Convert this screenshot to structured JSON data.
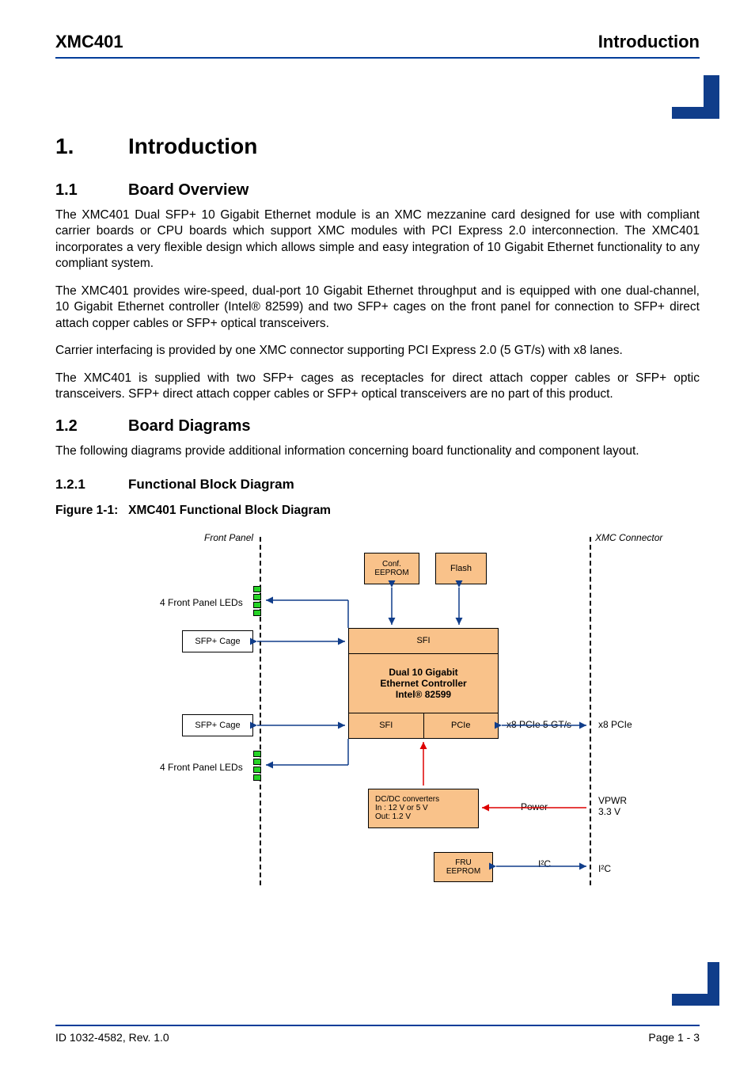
{
  "header": {
    "left": "XMC401",
    "right": "Introduction"
  },
  "chapter": {
    "num": "1.",
    "title": "Introduction"
  },
  "s11": {
    "num": "1.1",
    "title": "Board Overview",
    "p1": "The XMC401 Dual SFP+ 10 Gigabit Ethernet module is an XMC mezzanine card designed for use with compliant carrier boards or CPU boards which support XMC modules with PCI Express 2.0 interconnection. The XMC401 incorporates a very flexible design which allows simple and easy integration of 10 Gigabit Ethernet functionality to any compliant system.",
    "p2": "The XMC401 provides wire-speed, dual-port 10 Gigabit Ethernet throughput and is equipped with one dual-channel, 10 Gigabit Ethernet controller (Intel® 82599) and two SFP+ cages on the front panel for connection to SFP+ direct attach copper cables or SFP+ optical transceivers.",
    "p3": "Carrier interfacing is provided by one XMC connector supporting PCI Express 2.0 (5 GT/s) with x8 lanes.",
    "p4": "The XMC401 is supplied with two SFP+ cages as receptacles for direct attach copper cables or SFP+ optic transceivers. SFP+ direct attach copper cables or SFP+ optical transceivers are no part of this product."
  },
  "s12": {
    "num": "1.2",
    "title": "Board Diagrams",
    "p1": "The following diagrams provide additional information concerning board functionality and component layout."
  },
  "s121": {
    "num": "1.2.1",
    "title": "Functional Block Diagram"
  },
  "figure": {
    "label": "Figure 1-1:",
    "title": "XMC401 Functional Block Diagram"
  },
  "diagram": {
    "front_panel": "Front Panel",
    "xmc_connector": "XMC Connector",
    "leds_label": "4 Front Panel LEDs",
    "sfp_cage": "SFP+ Cage",
    "conf_eeprom_l1": "Conf.",
    "conf_eeprom_l2": "EEPROM",
    "flash": "Flash",
    "sfi": "SFI",
    "controller_l1": "Dual 10 Gigabit",
    "controller_l2": "Ethernet Controller",
    "controller_l3": "Intel® 82599",
    "pcie": "PCIe",
    "bus_label": "x8 PCIe   5 GT/s",
    "x8pcie": "x8 PCIe",
    "dcdc_l1": "DC/DC converters",
    "dcdc_l2": "In   :  12 V or 5 V",
    "dcdc_l3": "Out: 1.2 V",
    "power": "Power",
    "vpwr_l1": "VPWR",
    "vpwr_l2": "3.3 V",
    "fru_l1": "FRU",
    "fru_l2": "EEPROM",
    "i2c": "I²C"
  },
  "footer": {
    "left": "ID 1032-4582, Rev. 1.0",
    "right": "Page 1 - 3"
  }
}
